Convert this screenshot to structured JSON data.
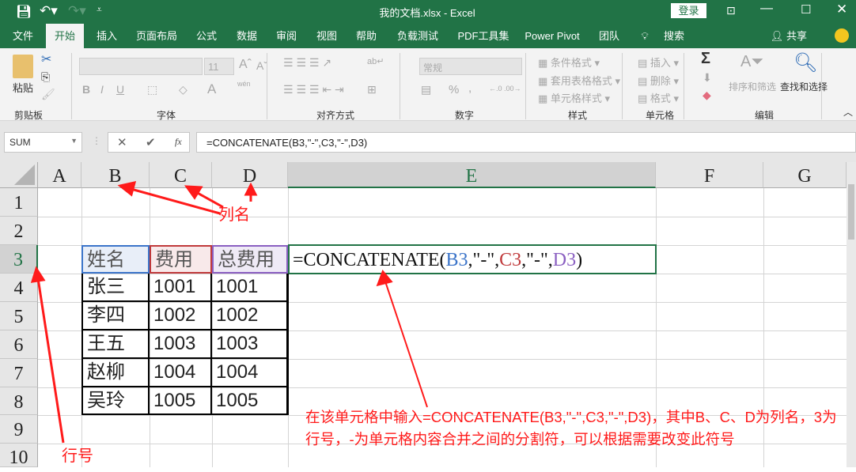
{
  "title_bar": {
    "title": "我的文档.xlsx  -  Excel",
    "login": "登录"
  },
  "tabs": [
    "文件",
    "开始",
    "插入",
    "页面布局",
    "公式",
    "数据",
    "审阅",
    "视图",
    "帮助",
    "负载测试",
    "PDF工具集",
    "Power Pivot",
    "团队",
    "搜索"
  ],
  "active_tab": "开始",
  "share": "共享",
  "ribbon": {
    "clipboard": {
      "label": "剪贴板",
      "paste": "粘贴"
    },
    "font": {
      "label": "字体",
      "size": "11",
      "bold": "B",
      "italic": "I",
      "underline": "U",
      "font_color": "A",
      "phonetic": "wén"
    },
    "alignment": {
      "label": "对齐方式"
    },
    "number": {
      "label": "数字",
      "format": "常规",
      "percent": "%",
      "comma": ","
    },
    "styles": {
      "label": "样式",
      "conditional": "条件格式",
      "table": "套用表格格式",
      "cell_styles": "单元格样式"
    },
    "cells": {
      "label": "单元格",
      "insert": "插入",
      "delete": "删除",
      "format": "格式"
    },
    "editing": {
      "label": "编辑",
      "sort": "排序和筛选",
      "find": "查找和选择",
      "sum": "Σ"
    }
  },
  "formula_bar": {
    "name_box": "SUM",
    "formula": "=CONCATENATE(B3,\"-\",C3,\"-\",D3)",
    "fx": "fx"
  },
  "columns": [
    "A",
    "B",
    "C",
    "D",
    "E",
    "F",
    "G"
  ],
  "rows": [
    "1",
    "2",
    "3",
    "4",
    "5",
    "6",
    "7",
    "8",
    "9",
    "10"
  ],
  "table": {
    "headers": [
      "姓名",
      "费用",
      "总费用"
    ],
    "data": [
      [
        "张三",
        "1001",
        "1001"
      ],
      [
        "李四",
        "1002",
        "1002"
      ],
      [
        "王五",
        "1003",
        "1003"
      ],
      [
        "赵柳",
        "1004",
        "1004"
      ],
      [
        "吴玲",
        "1005",
        "1005"
      ]
    ]
  },
  "edit_cell": {
    "prefix": "=CONCATENATE(",
    "b3": "B3",
    "sep1": ",\"-\",",
    "c3": "C3",
    "sep2": ",\"-\",",
    "d3": "D3",
    "suffix": ")"
  },
  "annotations": {
    "col_name": "列名",
    "row_number": "行号",
    "explanation": "在该单元格中输入=CONCATENATE(B3,\"-\",C3,\"-\",D3)，其中B、C、D为列名，3为行号，-为单元格内容合并之间的分割符，可以根据需要改变此符号"
  },
  "colors": {
    "excel_green": "#217346",
    "ref_blue": "#3b74c9",
    "ref_red": "#c0393b",
    "ref_purple": "#8a5fc1",
    "annotation_red": "#ff1a1a"
  }
}
